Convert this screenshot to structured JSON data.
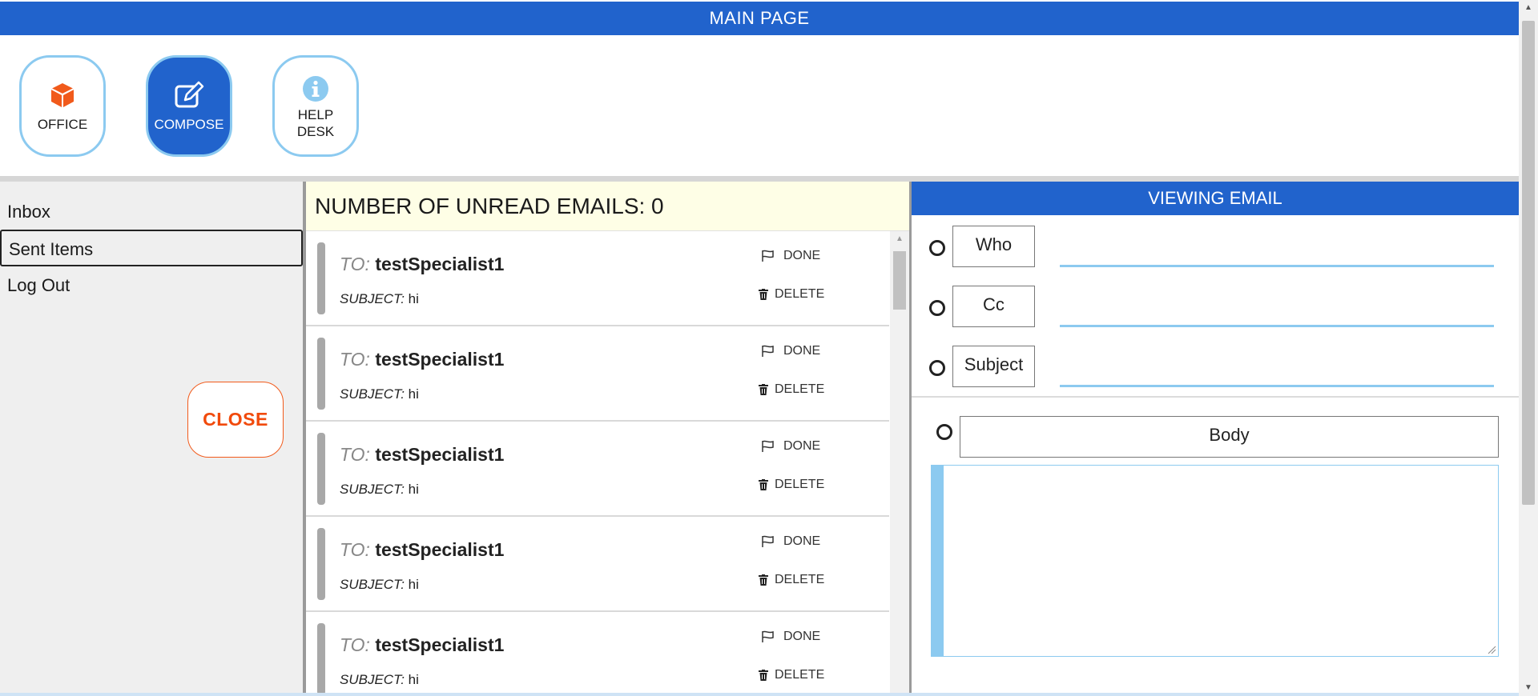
{
  "header": {
    "title": "MAIN PAGE"
  },
  "toolbar": {
    "buttons": [
      {
        "label": "OFFICE",
        "icon": "cube-icon",
        "active": false
      },
      {
        "label": "COMPOSE",
        "icon": "edit-icon",
        "active": true
      },
      {
        "label_line1": "HELP",
        "label_line2": "DESK",
        "icon": "info-icon",
        "active": false
      }
    ]
  },
  "sidebar": {
    "items": [
      {
        "label": "Inbox"
      },
      {
        "label": "Sent Items"
      },
      {
        "label": "Log Out"
      }
    ],
    "close_label": "CLOSE"
  },
  "email_list": {
    "unread_text": "NUMBER OF UNREAD EMAILS: 0",
    "to_key": "TO:",
    "subject_key": "SUBJECT:",
    "done_label": "DONE",
    "delete_label": "DELETE",
    "emails": [
      {
        "to": "testSpecialist1",
        "subject": "hi"
      },
      {
        "to": "testSpecialist1",
        "subject": "hi"
      },
      {
        "to": "testSpecialist1",
        "subject": "hi"
      },
      {
        "to": "testSpecialist1",
        "subject": "hi"
      },
      {
        "to": "testSpecialist1",
        "subject": "hi"
      }
    ]
  },
  "viewer": {
    "title": "VIEWING EMAIL",
    "who_label": "Who",
    "cc_label": "Cc",
    "subject_label": "Subject",
    "body_label": "Body",
    "who_value": "",
    "cc_value": "",
    "subject_value": "",
    "body_value": ""
  },
  "colors": {
    "primary": "#2163cc",
    "accent_light": "#8ccaf0",
    "close": "#f14a0c",
    "office_icon": "#f15a1b",
    "unread_bg": "#fefee6"
  }
}
